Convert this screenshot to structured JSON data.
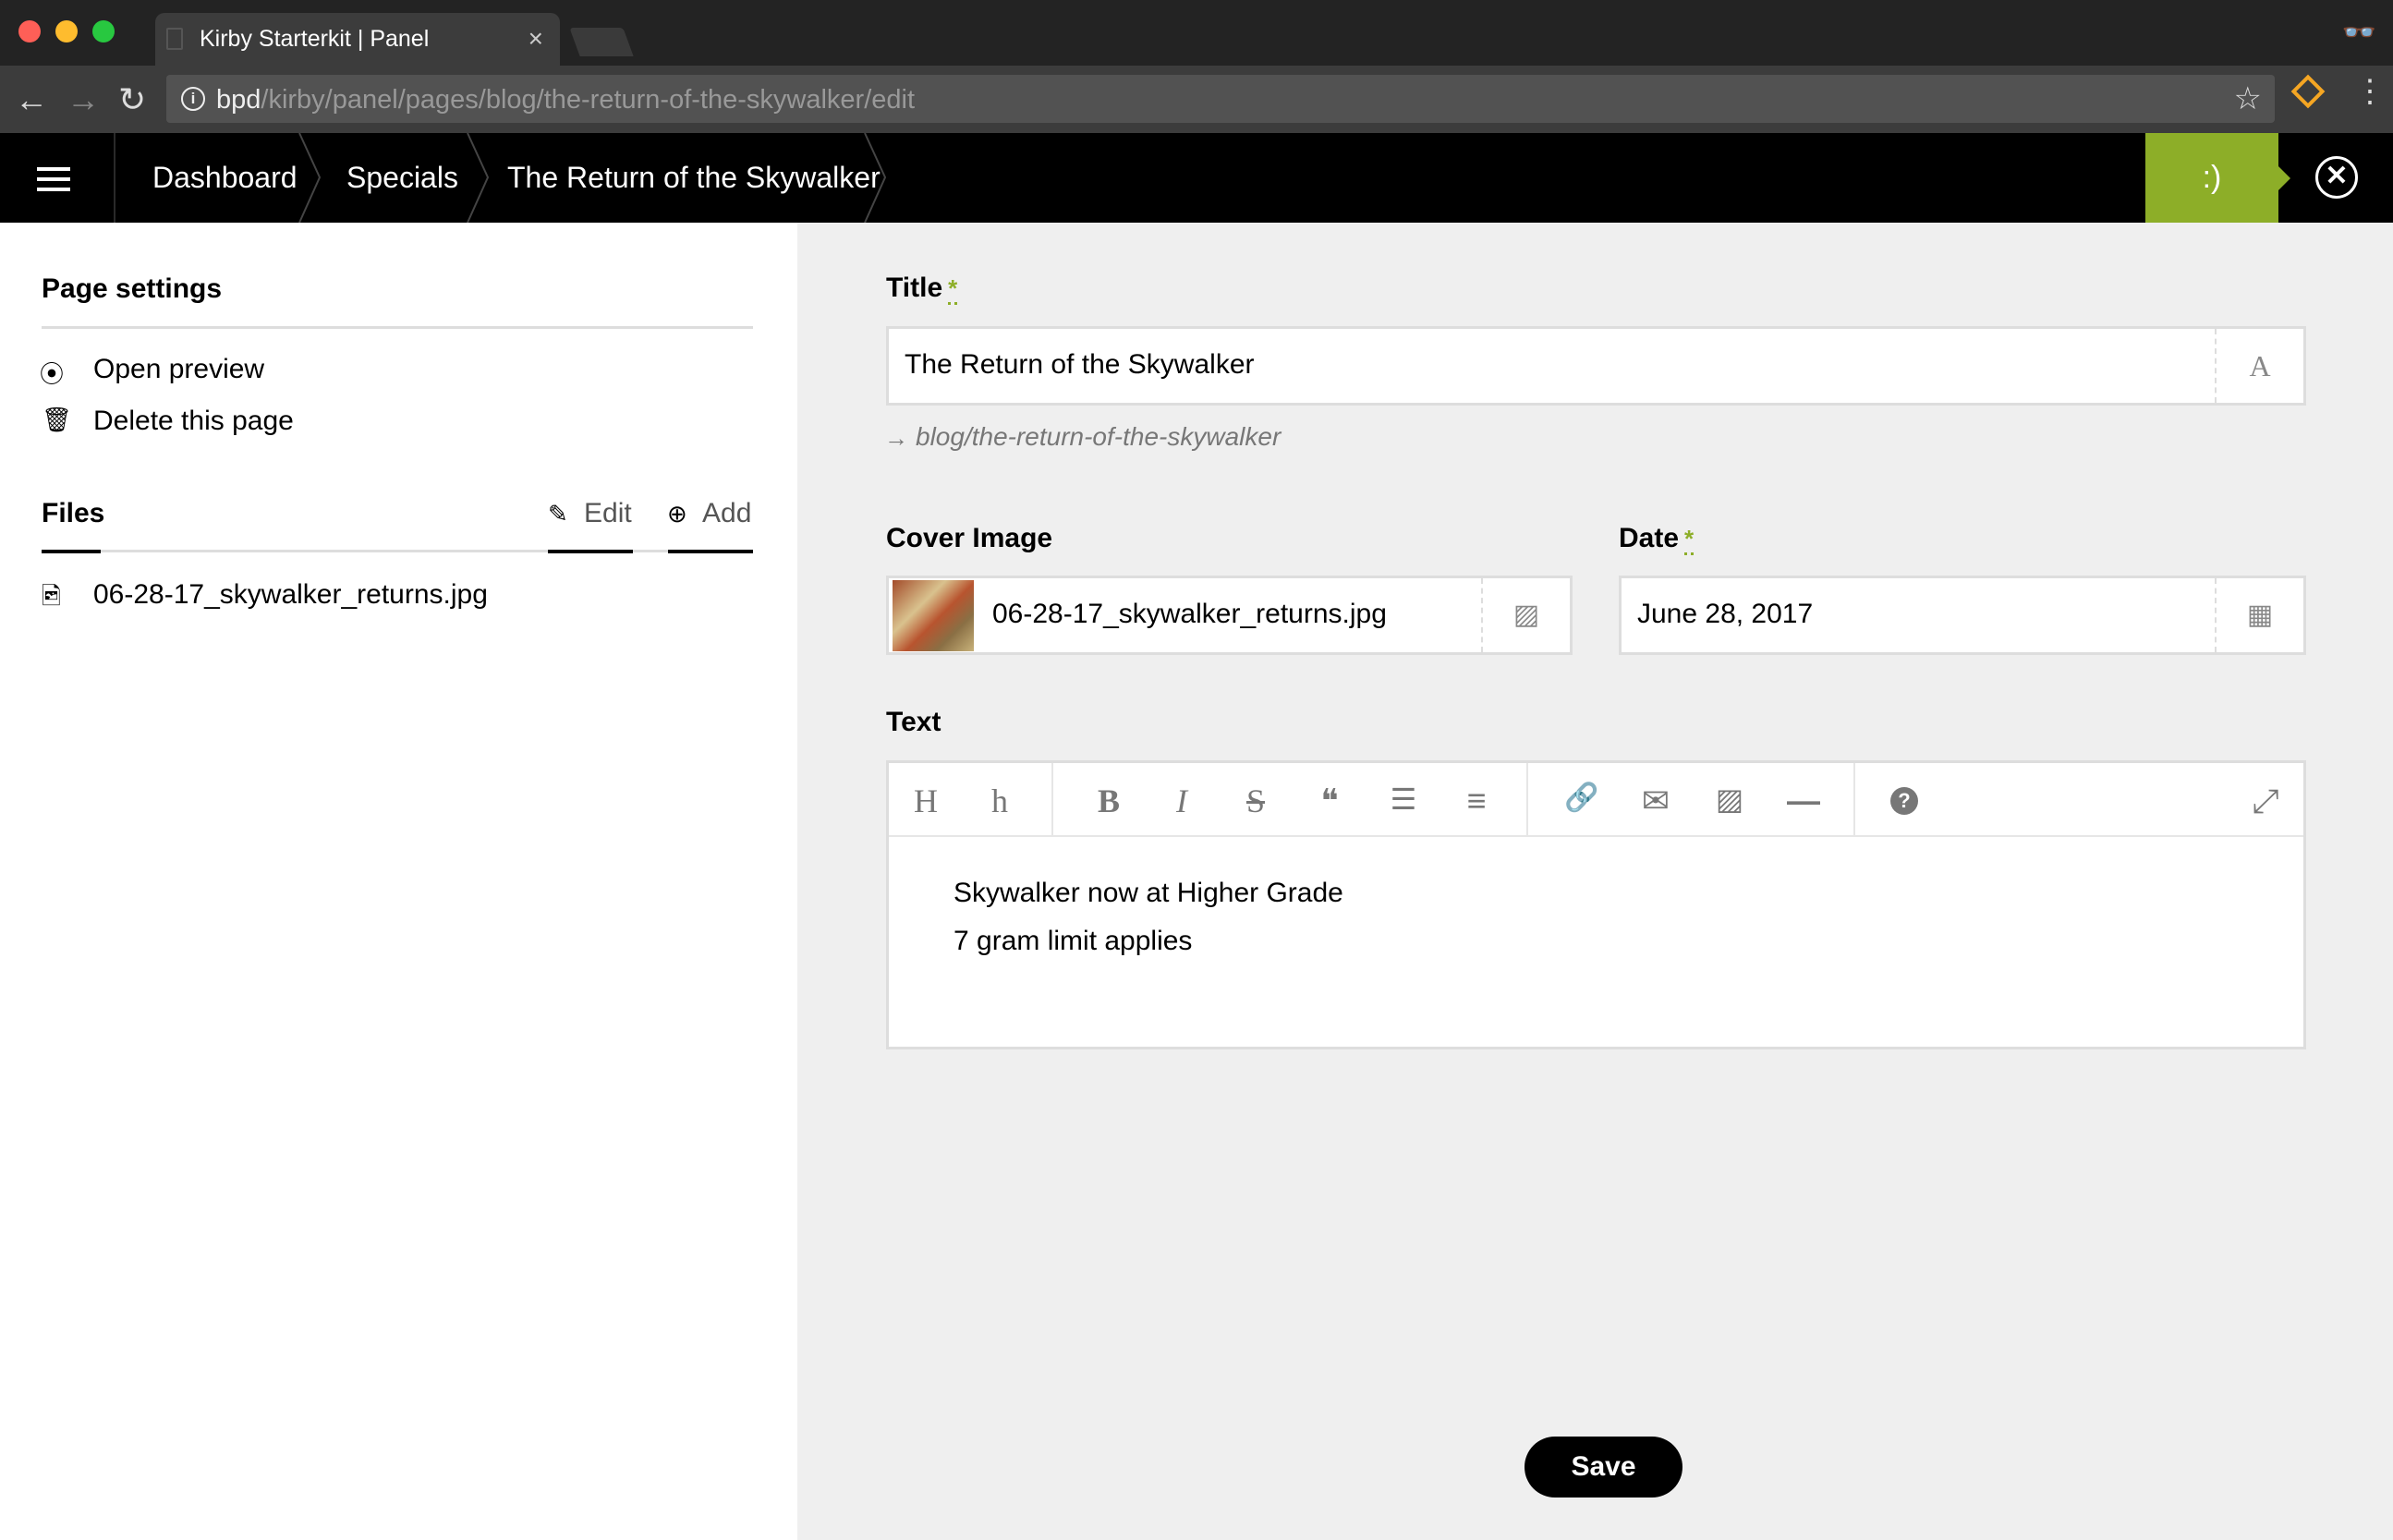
{
  "browser": {
    "tab_title": "Kirby Starterkit | Panel",
    "tab_close": "×",
    "url_host": "bpd",
    "url_path": "/kirby/panel/pages/blog/the-return-of-the-skywalker/edit",
    "dot_colors": [
      "#fe5f57",
      "#febc2e",
      "#28c840"
    ]
  },
  "topbar": {
    "breadcrumb": [
      "Dashboard",
      "Specials",
      "The Return of the Skywalker"
    ],
    "status": ":)",
    "close": "✕"
  },
  "sidebar": {
    "page_settings_heading": "Page settings",
    "actions": [
      {
        "label": "Open preview",
        "icon": "play-circle-icon"
      },
      {
        "label": "Delete this page",
        "icon": "trash-icon"
      }
    ],
    "files_heading": "Files",
    "files_edit": "Edit",
    "files_add": "Add",
    "files": [
      "06-28-17_skywalker_returns.jpg"
    ]
  },
  "form": {
    "title_label": "Title",
    "required_mark": "*",
    "title_value": "The Return of the Skywalker",
    "title_icon": "A",
    "url_hint": "blog/the-return-of-the-skywalker",
    "cover_label": "Cover Image",
    "cover_value": "06-28-17_skywalker_returns.jpg",
    "date_label": "Date",
    "date_value": "June 28, 2017",
    "text_label": "Text",
    "text_lines": [
      "Skywalker now at Higher Grade",
      "7 gram limit applies"
    ],
    "toolbar": [
      {
        "glyph": "H",
        "name": "heading-1-icon"
      },
      {
        "glyph": "h",
        "name": "heading-2-icon"
      },
      {
        "glyph": "B",
        "name": "bold-icon"
      },
      {
        "glyph": "I",
        "name": "italic-icon"
      },
      {
        "glyph": "S",
        "name": "strikethrough-icon"
      },
      {
        "glyph": "❝",
        "name": "quote-icon"
      },
      {
        "glyph": "☰",
        "name": "bullet-list-icon"
      },
      {
        "glyph": "≡",
        "name": "numbered-list-icon"
      },
      {
        "glyph": "🔗",
        "name": "link-icon"
      },
      {
        "glyph": "✉",
        "name": "email-icon"
      },
      {
        "glyph": "▨",
        "name": "image-icon"
      },
      {
        "glyph": "—",
        "name": "line-icon"
      },
      {
        "glyph": "?",
        "name": "help-icon"
      },
      {
        "glyph": "⤢",
        "name": "fullscreen-icon"
      }
    ],
    "save_label": "Save"
  },
  "colors": {
    "accent": "#8dae28",
    "topbar": "#000000",
    "main_bg": "#efefef"
  }
}
